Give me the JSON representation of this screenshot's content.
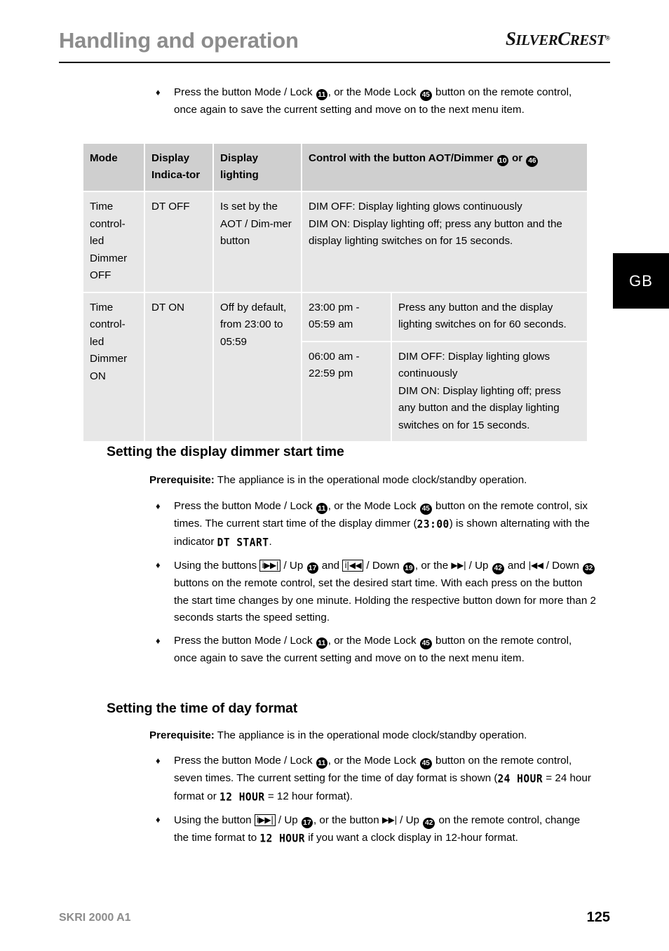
{
  "header": {
    "title": "Handling and operation",
    "brand_part1": "S",
    "brand_part2": "ILVER",
    "brand_part3": "C",
    "brand_part4": "REST",
    "brand_reg": "®"
  },
  "side_tab": {
    "label": "GB"
  },
  "intro_bullet": {
    "marker": "♦",
    "seg1": "Press the button Mode / Lock ",
    "badge1": "11",
    "seg2": ", or the Mode Lock ",
    "badge2": "45",
    "seg3": " button on the remote control, once again to save the current setting and move on to the next menu item."
  },
  "table": {
    "headers": {
      "mode": "Mode",
      "indicator": "Display Indica-tor",
      "lighting": "Display lighting",
      "control_seg1": "Control with the button AOT/Dimmer ",
      "control_badge1": "10",
      "control_seg2": " or ",
      "control_badge2": "46"
    },
    "rows": [
      {
        "mode": "Time control-led Dimmer OFF",
        "indicator": "DT OFF",
        "lighting": "Is set by the AOT / Dim-mer button",
        "control_line1": "DIM OFF: Display lighting glows continuously",
        "control_line2": "DIM ON: Display lighting off; press any button and the display lighting switches on for 15 seconds."
      },
      {
        "mode": "Time control-led Dimmer ON",
        "indicator": "DT ON",
        "lighting": "Off by default, from 23:00 to 05:59",
        "sub_rows": [
          {
            "time": "23:00 pm - 05:59 am",
            "line1": "Press any button and the display lighting switches on for 60 seconds.",
            "line2": ""
          },
          {
            "time": "06:00 am - 22:59 pm",
            "line1": "DIM OFF: Display lighting glows continuously",
            "line2": "DIM ON: Display lighting off; press any button and the display lighting switches on for 15 seconds."
          }
        ]
      }
    ]
  },
  "section1": {
    "heading": "Setting the display dimmer start time",
    "prereq_label": "Prerequisite:",
    "prereq_text": " The appliance is in the operational mode clock/standby operation.",
    "bullet1": {
      "marker": "♦",
      "seg1": "Press the button Mode / Lock ",
      "badge1": "11",
      "seg2": ", or the Mode Lock ",
      "badge2": "45",
      "seg3": " button on the remote control, six times. The current start time of the display dimmer (",
      "lcd1": "23:00",
      "seg4": ") is shown alternating with the indicator ",
      "lcd2": "DT START",
      "seg5": "."
    },
    "bullet2": {
      "marker": "♦",
      "seg1": "Using the buttons ",
      "key1": "i▶▶|",
      "seg2": " / Up ",
      "badge1": "17",
      "seg3": " and ",
      "key2": "i|◀◀",
      "seg4": " / Down ",
      "badge2": "19",
      "seg5": ", or the ",
      "key3": "▶▶|",
      "seg6": " / Up ",
      "badge3": "42",
      "seg7": " and ",
      "key4": "|◀◀",
      "seg8": " / Down ",
      "badge4": "32",
      "seg9": " buttons on the remote control, set the desired start time. With each press on the button the start time changes by one minute. Holding the respective button down for more than 2 seconds starts the speed setting."
    },
    "bullet3": {
      "marker": "♦",
      "seg1": "Press the button Mode / Lock ",
      "badge1": "11",
      "seg2": ", or the Mode Lock ",
      "badge2": "45",
      "seg3": " button on the remote control, once again to save the current setting and move on to the next menu item."
    }
  },
  "section2": {
    "heading": "Setting the time of day format",
    "prereq_label": "Prerequisite:",
    "prereq_text": " The appliance is in the operational mode clock/standby operation.",
    "bullet1": {
      "marker": "♦",
      "seg1": "Press the button Mode / Lock ",
      "badge1": "11",
      "seg2": ", or the Mode Lock ",
      "badge2": "45",
      "seg3": " button on the remote control, seven times. The current setting for the time of day format is shown (",
      "lcd1": "24 HOUR",
      "seg4": " = 24 hour format or ",
      "lcd2": "12 HOUR",
      "seg5": " = 12 hour format)."
    },
    "bullet2": {
      "marker": "♦",
      "seg1": "Using the button ",
      "key1": "i▶▶|",
      "seg2": " / Up ",
      "badge1": "17",
      "seg3": ", or the button ",
      "key2": "▶▶|",
      "seg4": " / Up ",
      "badge2": "42",
      "seg5": " on the remote control, change the time format to ",
      "lcd1": "12 HOUR",
      "seg6": " if you want a clock display in 12-hour format."
    }
  },
  "footer": {
    "model": "SKRI 2000 A1",
    "page": "125"
  }
}
